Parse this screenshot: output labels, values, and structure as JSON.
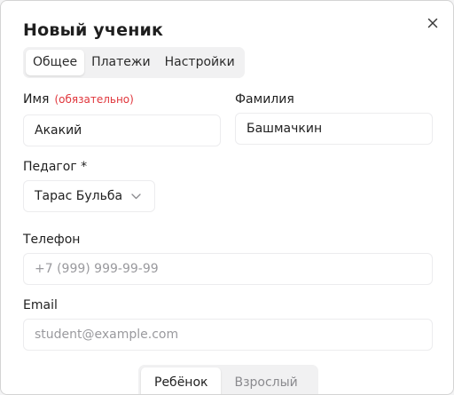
{
  "dialog": {
    "title": "Новый ученик",
    "close_icon": "close-icon"
  },
  "tabs": [
    {
      "label": "Общее",
      "active": true
    },
    {
      "label": "Платежи",
      "active": false
    },
    {
      "label": "Настройки",
      "active": false
    }
  ],
  "form": {
    "first_name": {
      "label": "Имя",
      "required_hint": "(обязательно)",
      "value": "Акакий"
    },
    "last_name": {
      "label": "Фамилия",
      "value": "Башмачкин"
    },
    "teacher": {
      "label": "Педагог *",
      "value": "Тарас Бульба",
      "icon": "chevron-down-icon"
    },
    "phone": {
      "label": "Телефон",
      "placeholder": "+7 (999) 999-99-99"
    },
    "email": {
      "label": "Email",
      "placeholder": "student@example.com"
    }
  },
  "student_type": {
    "options": [
      "Ребёнок",
      "Взрослый"
    ],
    "selected": "Ребёнок"
  },
  "colors": {
    "required": "#e0363c",
    "border": "#ececee",
    "muted": "#8a8a8e"
  }
}
